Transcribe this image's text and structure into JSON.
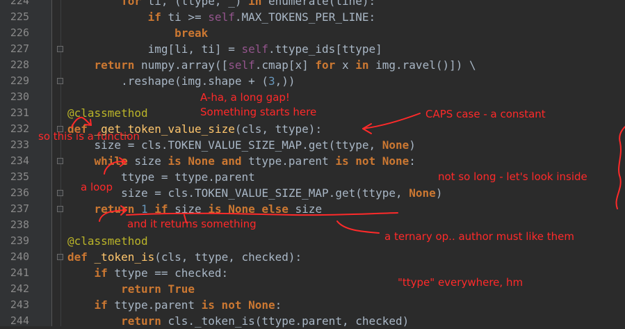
{
  "gutter": {
    "line_numbers": [
      "224",
      "225",
      "226",
      "227",
      "228",
      "229",
      "230",
      "231",
      "232",
      "233",
      "234",
      "235",
      "236",
      "237",
      "238",
      "239",
      "240",
      "241",
      "242",
      "243",
      "244"
    ]
  },
  "code": {
    "l224": [
      {
        "t": "        "
      },
      {
        "t": "for",
        "c": "kw"
      },
      {
        "t": " ti, (ttype, _) "
      },
      {
        "t": "in",
        "c": "kw"
      },
      {
        "t": " enumerate(line):"
      }
    ],
    "l225": [
      {
        "t": "            "
      },
      {
        "t": "if",
        "c": "kw"
      },
      {
        "t": " ti >= "
      },
      {
        "t": "self",
        "c": "self"
      },
      {
        "t": ".MAX_TOKENS_PER_LINE:"
      }
    ],
    "l226": [
      {
        "t": "                "
      },
      {
        "t": "break",
        "c": "kw"
      }
    ],
    "l227": [
      {
        "t": "            img[li, ti] = "
      },
      {
        "t": "self",
        "c": "self"
      },
      {
        "t": ".ttype_ids[ttype]"
      }
    ],
    "l228": [
      {
        "t": "    "
      },
      {
        "t": "return",
        "c": "kw"
      },
      {
        "t": " numpy.array(["
      },
      {
        "t": "self",
        "c": "self"
      },
      {
        "t": ".cmap[x] "
      },
      {
        "t": "for",
        "c": "kw"
      },
      {
        "t": " x "
      },
      {
        "t": "in",
        "c": "kw"
      },
      {
        "t": " img.ravel()]) \\"
      }
    ],
    "l229": [
      {
        "t": "        .reshape(img.shape + ("
      },
      {
        "t": "3",
        "c": "num"
      },
      {
        "t": ",))"
      }
    ],
    "l230": [],
    "l231": [
      {
        "t": "@classmethod",
        "c": "deco"
      }
    ],
    "l232": [
      {
        "t": "def",
        "c": "kw"
      },
      {
        "t": " "
      },
      {
        "t": "_get_token_value_size",
        "c": "fn"
      },
      {
        "t": "(cls, ttype):"
      }
    ],
    "l233": [
      {
        "t": "    size = cls.TOKEN_VALUE_SIZE_MAP.get(ttype, "
      },
      {
        "t": "None",
        "c": "kw"
      },
      {
        "t": ")"
      }
    ],
    "l234": [
      {
        "t": "    "
      },
      {
        "t": "while",
        "c": "kw"
      },
      {
        "t": " size "
      },
      {
        "t": "is None and",
        "c": "kw"
      },
      {
        "t": " ttype.parent "
      },
      {
        "t": "is not None",
        "c": "kw"
      },
      {
        "t": ":"
      }
    ],
    "l235": [
      {
        "t": "        ttype = ttype.parent"
      }
    ],
    "l236": [
      {
        "t": "        size = cls.TOKEN_VALUE_SIZE_MAP.get(ttype, "
      },
      {
        "t": "None",
        "c": "kw"
      },
      {
        "t": ")"
      }
    ],
    "l237": [
      {
        "t": "    "
      },
      {
        "t": "return",
        "c": "kw"
      },
      {
        "t": " "
      },
      {
        "t": "1",
        "c": "num"
      },
      {
        "t": " "
      },
      {
        "t": "if",
        "c": "kw"
      },
      {
        "t": " size "
      },
      {
        "t": "is None else",
        "c": "kw"
      },
      {
        "t": " size"
      }
    ],
    "l238": [],
    "l239": [
      {
        "t": "@classmethod",
        "c": "deco"
      }
    ],
    "l240": [
      {
        "t": "def",
        "c": "kw"
      },
      {
        "t": " "
      },
      {
        "t": "_token_is",
        "c": "fn"
      },
      {
        "t": "(cls, ttype, checked):"
      }
    ],
    "l241": [
      {
        "t": "    "
      },
      {
        "t": "if",
        "c": "kw"
      },
      {
        "t": " ttype == checked:"
      }
    ],
    "l242": [
      {
        "t": "        "
      },
      {
        "t": "return True",
        "c": "kw"
      }
    ],
    "l243": [
      {
        "t": "    "
      },
      {
        "t": "if",
        "c": "kw"
      },
      {
        "t": " ttype.parent "
      },
      {
        "t": "is not None",
        "c": "kw"
      },
      {
        "t": ":"
      }
    ],
    "l244": [
      {
        "t": "        "
      },
      {
        "t": "return",
        "c": "kw"
      },
      {
        "t": " cls._token_is(ttype.parent, checked)"
      }
    ]
  },
  "annotations": {
    "aha": "A-ha, a long gap!",
    "something_starts": "Something starts here",
    "caps": "CAPS case - a constant",
    "function": "so this is a function",
    "not_so_long": "not so long - let's look inside",
    "loop": "a loop",
    "returns": "and it returns something",
    "ternary": "a ternary op.. author must like them",
    "ttype": "\"ttype\" everywhere, hm"
  },
  "colors": {
    "annotation": "#ff2a2a",
    "keyword": "#cc7832",
    "self": "#94558d",
    "decorator": "#bbb529",
    "number": "#6897bb",
    "function_name": "#ffc66d",
    "text": "#a9b7c6",
    "background": "#2b2b2b"
  }
}
